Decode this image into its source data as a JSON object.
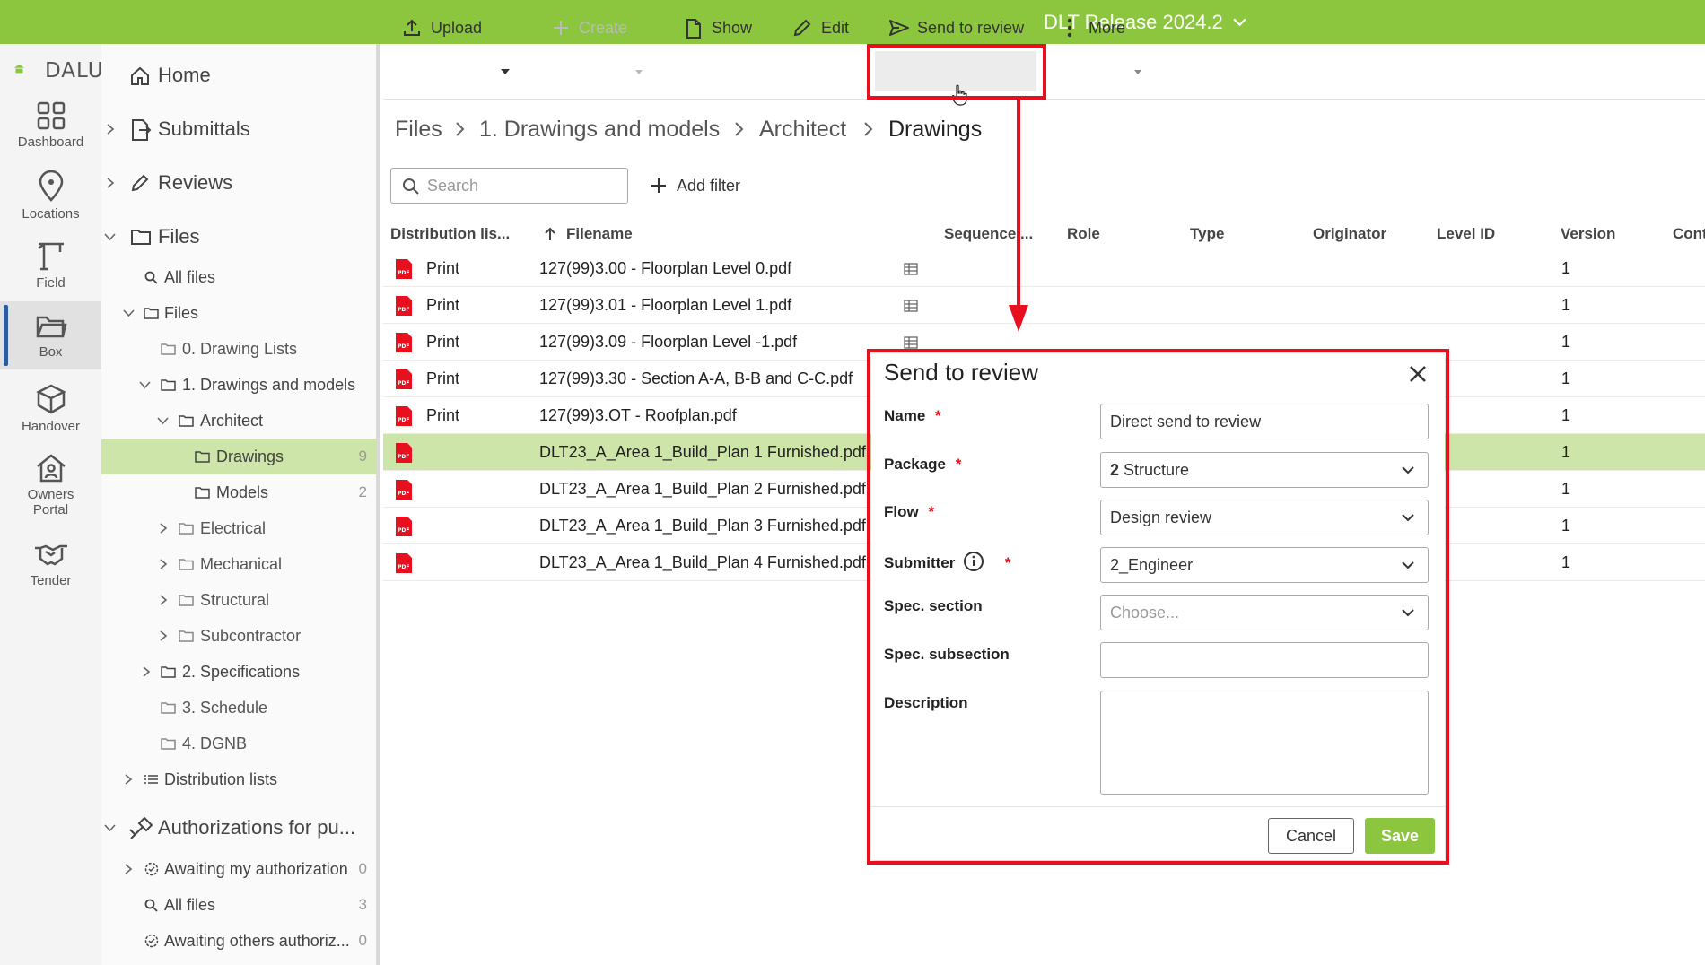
{
  "header": {
    "release": "DLT Release 2024.2"
  },
  "brand": {
    "logo_text": "DALUX"
  },
  "rail": [
    {
      "label": "Dashboard",
      "icon": "dashboard-icon"
    },
    {
      "label": "Locations",
      "icon": "location-pin-icon"
    },
    {
      "label": "Field",
      "icon": "crane-icon"
    },
    {
      "label": "Box",
      "icon": "folder-open-icon"
    },
    {
      "label": "Handover",
      "icon": "box-icon"
    },
    {
      "label": "Owners Portal",
      "icon": "house-user-icon"
    },
    {
      "label": "Tender",
      "icon": "handshake-icon"
    }
  ],
  "nav": {
    "home": "Home",
    "submittals": "Submittals",
    "reviews": "Reviews",
    "files": "Files",
    "all_files": "All files",
    "files_folder": "Files",
    "drawing_lists": "0. Drawing Lists",
    "drawings_models": "1. Drawings and models",
    "architect": "Architect",
    "drawings": "Drawings",
    "drawings_count": "9",
    "models": "Models",
    "models_count": "2",
    "electrical": "Electrical",
    "mechanical": "Mechanical",
    "structural": "Structural",
    "subcontractor": "Subcontractor",
    "specifications": "2. Specifications",
    "schedule": "3. Schedule",
    "dgnb": "4. DGNB",
    "distribution_lists": "Distribution lists",
    "authorizations": "Authorizations for pu...",
    "awaiting_my": "Awaiting my authorization",
    "awaiting_my_count": "0",
    "auth_all_files": "All files",
    "auth_all_files_count": "3",
    "awaiting_others": "Awaiting others authoriz...",
    "awaiting_others_count": "0"
  },
  "toolbar": {
    "upload": "Upload",
    "create": "Create",
    "show": "Show",
    "edit": "Edit",
    "send_to_review": "Send to review",
    "more": "More"
  },
  "breadcrumb": [
    "Files",
    "1. Drawings and models",
    "Architect",
    "Drawings"
  ],
  "search": {
    "placeholder": "Search"
  },
  "filter": {
    "add_label": "Add filter"
  },
  "table": {
    "columns": {
      "distribution": "Distribution lis...",
      "filename": "Filename",
      "sequence": "Sequence ...",
      "role": "Role",
      "type": "Type",
      "originator": "Originator",
      "level_id": "Level ID",
      "version": "Version",
      "cont": "Cont"
    },
    "rows": [
      {
        "dist": "Print",
        "filename": "127(99)3.00 - Floorplan Level 0.pdf",
        "version": "1"
      },
      {
        "dist": "Print",
        "filename": "127(99)3.01 - Floorplan Level 1.pdf",
        "version": "1"
      },
      {
        "dist": "Print",
        "filename": "127(99)3.09 - Floorplan Level -1.pdf",
        "version": "1"
      },
      {
        "dist": "Print",
        "filename": "127(99)3.30 - Section A-A, B-B and C-C.pdf",
        "version": "1"
      },
      {
        "dist": "Print",
        "filename": "127(99)3.OT - Roofplan.pdf",
        "version": "1"
      },
      {
        "dist": "",
        "filename": "DLT23_A_Area 1_Build_Plan 1 Furnished.pdf",
        "version": "1"
      },
      {
        "dist": "",
        "filename": "DLT23_A_Area 1_Build_Plan 2 Furnished.pdf",
        "version": "1"
      },
      {
        "dist": "",
        "filename": "DLT23_A_Area 1_Build_Plan 3 Furnished.pdf",
        "version": "1"
      },
      {
        "dist": "",
        "filename": "DLT23_A_Area 1_Build_Plan 4 Furnished.pdf",
        "version": "1"
      }
    ]
  },
  "dialog": {
    "title": "Send to review",
    "required_mark": "*",
    "name_label": "Name",
    "name_value": "Direct send to review",
    "package_label": "Package",
    "package_value_num": "2",
    "package_value_text": "Structure",
    "flow_label": "Flow",
    "flow_value": "Design review",
    "submitter_label": "Submitter",
    "submitter_value": "2_Engineer",
    "spec_section_label": "Spec. section",
    "spec_section_placeholder": "Choose...",
    "spec_subsection_label": "Spec. subsection",
    "spec_subsection_value": "",
    "description_label": "Description",
    "description_value": "",
    "cancel": "Cancel",
    "save": "Save"
  },
  "colors": {
    "brand_green": "#8cc63f",
    "highlight_red": "#e8101e",
    "selected_row": "#cde5a8"
  }
}
